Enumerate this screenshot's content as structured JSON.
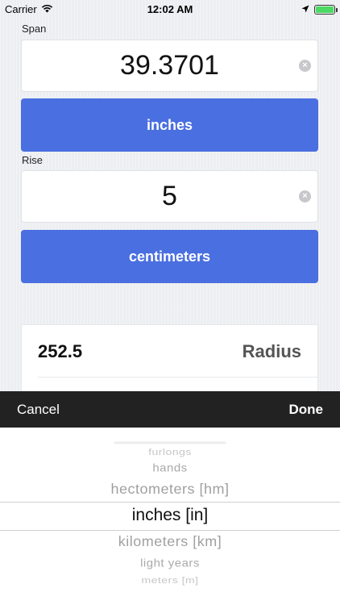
{
  "status_bar": {
    "carrier": "Carrier",
    "time": "12:02 AM",
    "battery_level": 1.0
  },
  "span": {
    "label": "Span",
    "value": "39.3701",
    "unit_button": "inches"
  },
  "rise": {
    "label": "Rise",
    "value": "5",
    "unit_button": "centimeters"
  },
  "result": {
    "value": "252.5",
    "label": "Radius"
  },
  "picker_toolbar": {
    "cancel": "Cancel",
    "done": "Done"
  },
  "picker": {
    "items": [
      "furlongs",
      "hands",
      "hectometers [hm]",
      "inches [in]",
      "kilometers [km]",
      "light years",
      "meters [m]"
    ],
    "selected": "inches [in]"
  },
  "colors": {
    "accent": "#4a6fe0",
    "toolbar": "#222222",
    "background": "#eceef1"
  }
}
